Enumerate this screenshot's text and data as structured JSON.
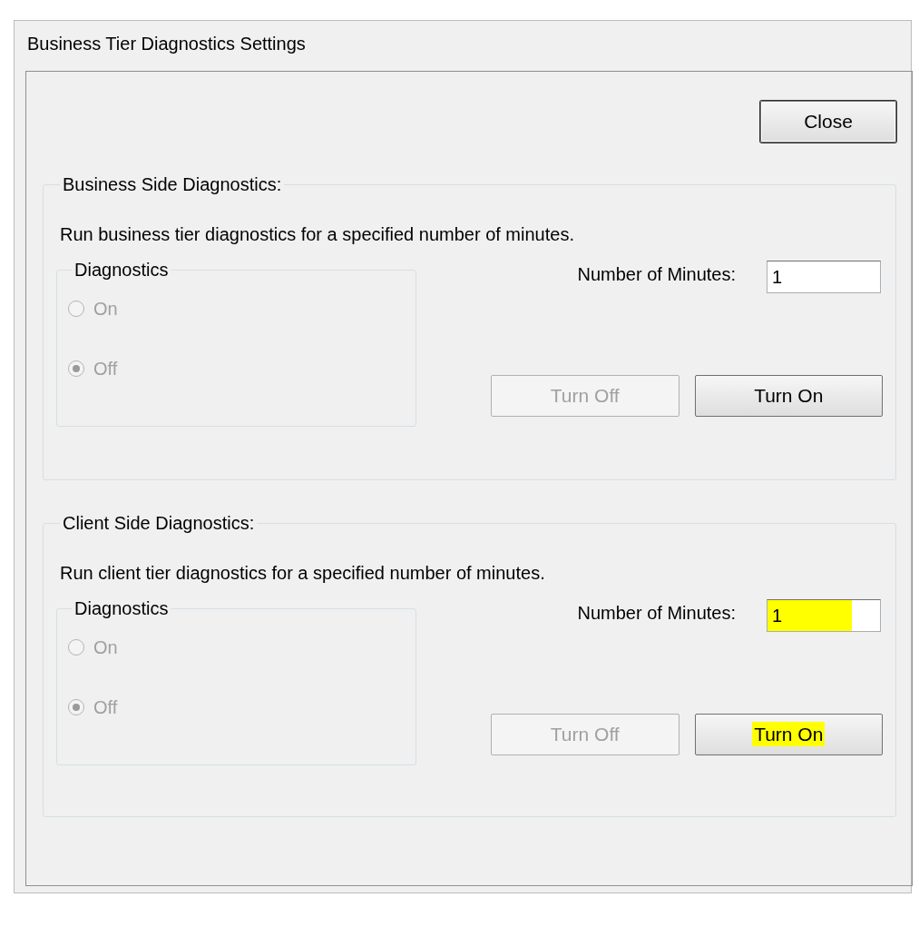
{
  "window": {
    "title": "Business Tier Diagnostics Settings"
  },
  "close_button": {
    "label": "Close"
  },
  "sections": [
    {
      "title": "Business Side Diagnostics:",
      "description": "Run business tier diagnostics for a specified number of minutes.",
      "group": {
        "title": "Diagnostics",
        "options": [
          {
            "label": "On",
            "selected": false,
            "disabled": true
          },
          {
            "label": "Off",
            "selected": true,
            "disabled": true
          }
        ]
      },
      "minutes": {
        "label": "Number of Minutes:",
        "value": "1",
        "highlighted": false
      },
      "buttons": [
        {
          "label": "Turn Off",
          "disabled": true,
          "highlighted": false
        },
        {
          "label": "Turn On",
          "disabled": false,
          "highlighted": false
        }
      ]
    },
    {
      "title": "Client Side Diagnostics:",
      "description": "Run client tier diagnostics for a specified number of minutes.",
      "group": {
        "title": "Diagnostics",
        "options": [
          {
            "label": "On",
            "selected": false,
            "disabled": true
          },
          {
            "label": "Off",
            "selected": true,
            "disabled": true
          }
        ]
      },
      "minutes": {
        "label": "Number of Minutes:",
        "value": "1",
        "highlighted": true
      },
      "buttons": [
        {
          "label": "Turn Off",
          "disabled": true,
          "highlighted": false
        },
        {
          "label": "Turn On",
          "disabled": false,
          "highlighted": true
        }
      ]
    }
  ]
}
